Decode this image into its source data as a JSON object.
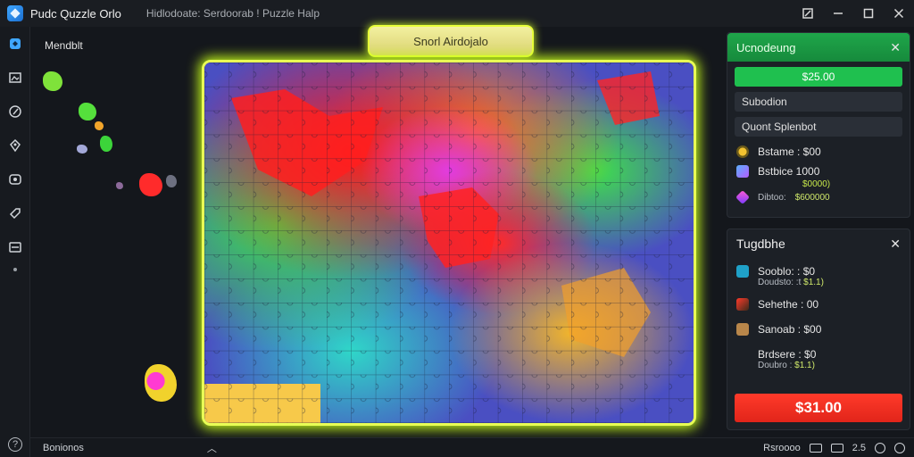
{
  "titlebar": {
    "app_title": "Pudc Quzzle Orlo",
    "window_title": "Hidlodoate: Serdoorab ! Puzzle Halp"
  },
  "left_pane": {
    "label": "Mendblt"
  },
  "banner": {
    "label": "Snorl Airdojalo"
  },
  "panel1": {
    "title": "Ucnodeung",
    "price": "$25.00",
    "row1": "Subodion",
    "row2": "Quont Splenbot",
    "stats": [
      {
        "text": "Bstame : $00"
      },
      {
        "text": "Bstbice  1000"
      }
    ],
    "tiny_green": "$0000)",
    "sub_label": "Dibtoo:",
    "sub_value": "$600000"
  },
  "panel2": {
    "title": "Tugdbhe",
    "stats": [
      {
        "text": "Sooblo: : $0",
        "sub": "Doudsto: :t ",
        "sub_hl": "$1.1)"
      },
      {
        "text": "Sehethe : 00"
      },
      {
        "text": "Sanoab : $00"
      },
      {
        "text": "Brdsere : $0",
        "sub": "Doubro : ",
        "sub_hl": "$1.1)"
      }
    ],
    "price": "$31.00"
  },
  "statusbar": {
    "left": "Bonionos",
    "right": "Rsroooo",
    "zoom": "2.5"
  },
  "colors": {
    "accent": "#3fa7ff",
    "board_glow": "#e9ff55",
    "price_green": "#1fc04f",
    "price_red": "#ff3a2a"
  }
}
